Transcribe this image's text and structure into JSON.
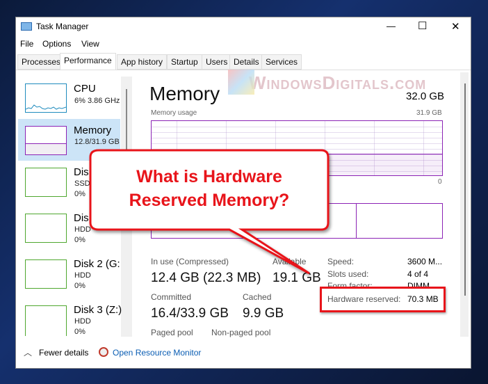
{
  "window": {
    "title": "Task Manager",
    "minimize": "—",
    "maximize": "☐",
    "close": "✕"
  },
  "menu": [
    "File",
    "Options",
    "View"
  ],
  "tabs": [
    "Processes",
    "Performance",
    "App history",
    "Startup",
    "Users",
    "Details",
    "Services"
  ],
  "active_tab": "Performance",
  "sidebar": [
    {
      "name": "CPU",
      "sub": "6%  3.86 GHz",
      "color": "#1e8bbd"
    },
    {
      "name": "Memory",
      "sub": "12.8/31.9 GB",
      "color": "#8b22b5",
      "selected": true
    },
    {
      "name": "Disk",
      "sub": "SSD",
      "sub2": "0%",
      "color": "#4ea72e"
    },
    {
      "name": "Dis",
      "sub": "HDD",
      "sub2": "0%",
      "color": "#4ea72e"
    },
    {
      "name": "Disk 2 (G:",
      "sub": "HDD",
      "sub2": "0%",
      "color": "#4ea72e"
    },
    {
      "name": "Disk 3 (Z:)",
      "sub": "HDD",
      "sub2": "0%",
      "color": "#4ea72e"
    }
  ],
  "main": {
    "title": "Memory",
    "total": "32.0 GB",
    "usage_label": "Memory usage",
    "usage_max": "31.9 GB",
    "usage_min": "0",
    "usage_fraction": 0.4,
    "stats": {
      "in_use_label": "In use (Compressed)",
      "in_use": "12.4 GB (22.3 MB)",
      "available_label": "Available",
      "available": "19.1 GB",
      "committed_label": "Committed",
      "committed": "16.4/33.9 GB",
      "cached_label": "Cached",
      "cached": "9.9 GB",
      "paged_label": "Paged pool",
      "nonpaged_label": "Non-paged pool"
    },
    "specs": [
      {
        "k": "Speed:",
        "v": "3600 M..."
      },
      {
        "k": "Slots used:",
        "v": "4 of 4"
      },
      {
        "k": "Form factor:",
        "v": "DIMM"
      },
      {
        "k": "Hardware reserved:",
        "v": "70.3 MB"
      }
    ]
  },
  "footer": {
    "fewer": "Fewer details",
    "monitor": "Open Resource Monitor"
  },
  "callout": {
    "line1": "What is Hardware",
    "line2": "Reserved Memory?",
    "color": "#e8141a"
  },
  "watermark": "WindowsDigitals.com"
}
